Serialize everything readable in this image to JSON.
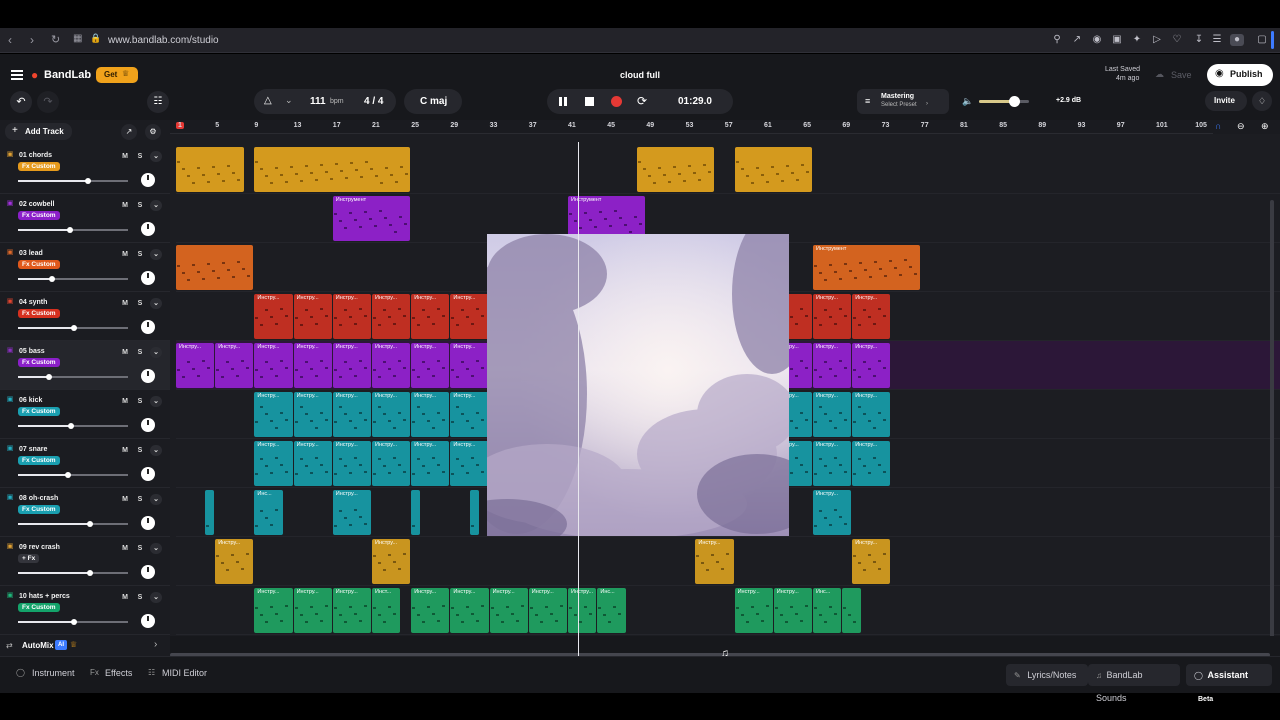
{
  "browser": {
    "url": "www.bandlab.com/studio"
  },
  "header": {
    "brand": "BandLab",
    "get_label": "Get",
    "project_title": "cloud full",
    "last_saved_label": "Last Saved",
    "last_saved_time": "4m ago",
    "save_label": "Save",
    "publish_label": "Publish",
    "invite_label": "Invite"
  },
  "transport": {
    "tempo": "111",
    "tempo_unit": "bpm",
    "time_signature": "4 / 4",
    "key": "C maj",
    "time": "01:29.0",
    "mastering_label": "Mastering",
    "mastering_preset": "Select Preset",
    "master_volume": "+2.9 dB",
    "master_volume_level": 0.7
  },
  "track_panel": {
    "add_track_label": "Add Track"
  },
  "tracks": [
    {
      "name": "01 chords",
      "fx": "Fx Custom",
      "fx_color": "#e59a1c",
      "icon_color": "#e0a133",
      "volume": 0.64
    },
    {
      "name": "02 cowbell",
      "fx": "Fx Custom",
      "fx_color": "#8b1fc9",
      "icon_color": "#a431e0",
      "volume": 0.47
    },
    {
      "name": "03 lead",
      "fx": "Fx Custom",
      "fx_color": "#e0581b",
      "icon_color": "#e06a2a",
      "volume": 0.31
    },
    {
      "name": "04 synth",
      "fx": "Fx Custom",
      "fx_color": "#d6301f",
      "icon_color": "#e0442f",
      "volume": 0.51
    },
    {
      "name": "05 bass",
      "fx": "Fx Custom",
      "fx_color": "#8b1fc9",
      "icon_color": "#8a2fc0",
      "volume": 0.28
    },
    {
      "name": "06 kick",
      "fx": "Fx Custom",
      "fx_color": "#1a9fb0",
      "icon_color": "#22b0c4",
      "volume": 0.48
    },
    {
      "name": "07 snare",
      "fx": "Fx Custom",
      "fx_color": "#1a9fb0",
      "icon_color": "#22b0c4",
      "volume": 0.45
    },
    {
      "name": "08 oh-crash",
      "fx": "Fx Custom",
      "fx_color": "#1a9fb0",
      "icon_color": "#22b0c4",
      "volume": 0.65
    },
    {
      "name": "09 rev crash",
      "fx": "+ Fx",
      "fx_color": "#34353c",
      "icon_color": "#e0a133",
      "volume": 0.65
    },
    {
      "name": "10 hats + percs",
      "fx": "Fx Custom",
      "fx_color": "#14a36a",
      "icon_color": "#1fb87a",
      "volume": 0.51
    }
  ],
  "track_buttons": {
    "mute": "M",
    "solo": "S"
  },
  "clip_labels": {
    "instrument": "Инструмент",
    "instrument_short": "Инстру...",
    "instrument_tiny": "Инс...",
    "instrument_mid": "Инст..."
  },
  "ruler": [
    "1",
    "5",
    "9",
    "13",
    "17",
    "21",
    "25",
    "29",
    "33",
    "37",
    "41",
    "45",
    "49",
    "53",
    "57",
    "61",
    "65",
    "69",
    "73",
    "77",
    "81",
    "85",
    "89",
    "93",
    "97",
    "101",
    "105"
  ],
  "automix": {
    "label": "AutoMix",
    "badge": "AI"
  },
  "bottom_tabs": {
    "instrument": "Instrument",
    "effects": "Effects",
    "midi_editor": "MIDI Editor",
    "lyrics": "Lyrics/Notes",
    "sounds": "BandLab Sounds",
    "assistant": "Assistant",
    "assistant_badge": "Beta"
  },
  "colors": {
    "accent_orange": "#f0a21b",
    "playhead": "#e8e8ee",
    "record_red": "#e53935"
  }
}
